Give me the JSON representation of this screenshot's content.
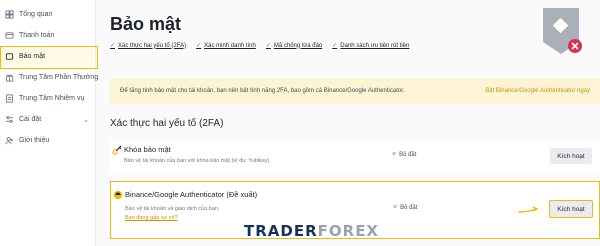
{
  "sidebar": {
    "items": [
      {
        "label": "Tổng quan",
        "icon": "overview-icon"
      },
      {
        "label": "Thanh toán",
        "icon": "payment-icon"
      },
      {
        "label": "Bảo mật",
        "icon": "shield-icon",
        "active": true
      },
      {
        "label": "Trung Tâm Phần Thưởng",
        "icon": "reward-icon"
      },
      {
        "label": "Trung Tâm Nhiệm vụ",
        "icon": "task-icon"
      },
      {
        "label": "Cài đặt",
        "icon": "settings-icon",
        "has_chevron": true
      },
      {
        "label": "Giới thiệu",
        "icon": "referral-icon"
      }
    ]
  },
  "main": {
    "title": "Bảo mật",
    "links": [
      "Xác thực hai yếu tố (2FA)",
      "Xác minh danh tính",
      "Mã chống lừa đảo",
      "Danh sách ưu tiên rút tiền"
    ],
    "banner": {
      "text": "Để tăng tính bảo mật cho tài khoản, bạn nên bật tính năng 2FA, bao gồm cả Binance/Google Authenticator.",
      "cta": "Bật Binance/Google Authenticator ngay"
    },
    "section_title": "Xác thực hai yếu tố (2FA)",
    "rows": [
      {
        "title": "Khóa bảo mật",
        "desc": "Bảo vệ tài khoản của bạn với khóa bảo mật (ví dụ: Yubikey).",
        "status": "Bỏ đặt",
        "button": "Kích hoạt"
      },
      {
        "title": "Binance/Google Authenticator (Đề xuất)",
        "desc": "Bảo vệ tài khoản và giao dịch của bạn.",
        "link": "Bạn đang gặp sự cố?",
        "status": "Bỏ đặt",
        "button": "Kích hoạt"
      }
    ]
  },
  "watermark": {
    "part1": "TRADER",
    "part2": "FOREX"
  },
  "colors": {
    "accent": "#f0b90b",
    "link": "#c99400",
    "banner_bg": "#fdf4d5"
  }
}
